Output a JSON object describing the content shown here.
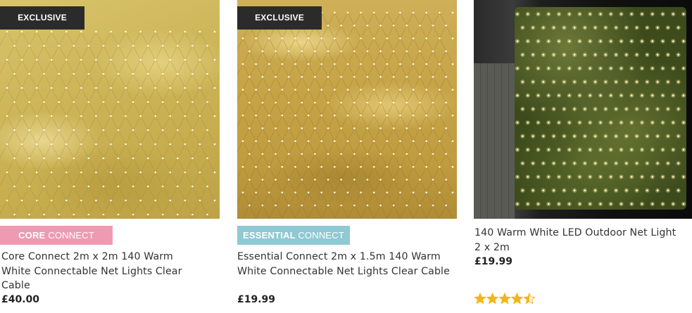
{
  "products": [
    {
      "badge": "EXCLUSIVE",
      "range_tag": {
        "bold": "CORE ",
        "light": "CONNECT"
      },
      "title": "Core Connect 2m x 2m 140 Warm White Connectable Net Lights Clear Cable",
      "price": "£40.00",
      "image": "warm-white-net-lights-yellow"
    },
    {
      "badge": "EXCLUSIVE",
      "range_tag": {
        "bold": "ESSENTIAL ",
        "light": "CONNECT"
      },
      "title": "Essential Connect 2m x 1.5m 140 Warm White Connectable Net Lights Clear Cable",
      "price": "£19.99",
      "image": "warm-white-net-lights-gold"
    },
    {
      "title": "140 Warm White LED Outdoor Net Light 2 x 2m",
      "price": "£19.99",
      "image": "net-lights-on-hedge-at-night",
      "rating": 4.5,
      "rating_max": 5
    }
  ],
  "colors": {
    "badge_bg": "#2b2b2b",
    "core_tag": "#ef9ab2",
    "essential_tag": "#8fc9d3",
    "star": "#f2b51c"
  }
}
